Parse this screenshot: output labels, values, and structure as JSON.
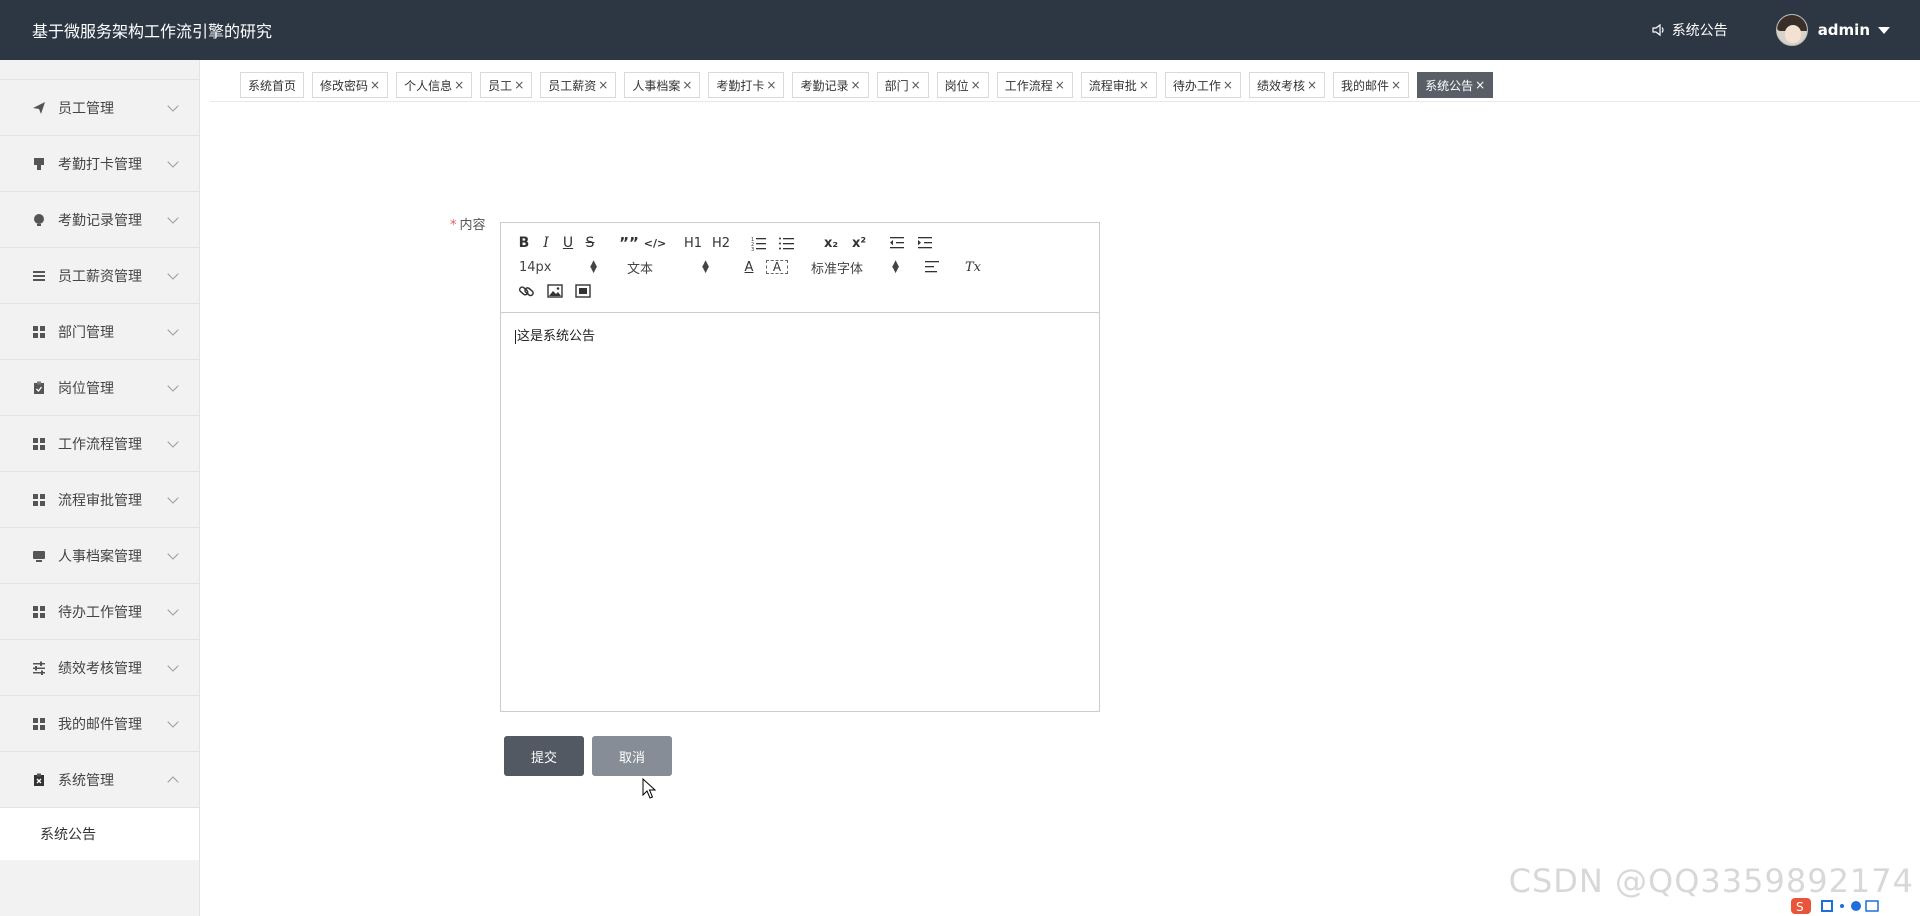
{
  "header": {
    "app_title": "基于微服务架构工作流引擎的研究",
    "notice_label": "系统公告",
    "username": "admin"
  },
  "sidebar": {
    "items": [
      {
        "label": "员工管理",
        "icon": "send-icon"
      },
      {
        "label": "考勤打卡管理",
        "icon": "stamp-icon"
      },
      {
        "label": "考勤记录管理",
        "icon": "bulb-icon"
      },
      {
        "label": "员工薪资管理",
        "icon": "list-icon"
      },
      {
        "label": "部门管理",
        "icon": "grid-icon"
      },
      {
        "label": "岗位管理",
        "icon": "clipboard-icon"
      },
      {
        "label": "工作流程管理",
        "icon": "grid-icon"
      },
      {
        "label": "流程审批管理",
        "icon": "grid-icon"
      },
      {
        "label": "人事档案管理",
        "icon": "monitor-icon"
      },
      {
        "label": "待办工作管理",
        "icon": "grid-icon"
      },
      {
        "label": "绩效考核管理",
        "icon": "sliders-icon"
      },
      {
        "label": "我的邮件管理",
        "icon": "grid-icon"
      },
      {
        "label": "系统管理",
        "icon": "clipboard-x-icon"
      }
    ],
    "sub_item": "系统公告"
  },
  "tabs": [
    {
      "label": "系统首页",
      "closable": false
    },
    {
      "label": "修改密码",
      "closable": true
    },
    {
      "label": "个人信息",
      "closable": true
    },
    {
      "label": "员工",
      "closable": true
    },
    {
      "label": "员工薪资",
      "closable": true
    },
    {
      "label": "人事档案",
      "closable": true
    },
    {
      "label": "考勤打卡",
      "closable": true
    },
    {
      "label": "考勤记录",
      "closable": true
    },
    {
      "label": "部门",
      "closable": true
    },
    {
      "label": "岗位",
      "closable": true
    },
    {
      "label": "工作流程",
      "closable": true
    },
    {
      "label": "流程审批",
      "closable": true
    },
    {
      "label": "待办工作",
      "closable": true
    },
    {
      "label": "绩效考核",
      "closable": true
    },
    {
      "label": "我的邮件",
      "closable": true
    },
    {
      "label": "系统公告",
      "closable": true,
      "active": true
    }
  ],
  "tab_close_glyph": "×",
  "form": {
    "required_mark": "*",
    "content_label": "内容",
    "editor_text": "这是系统公告",
    "font_size": "14px",
    "header_select": "文本",
    "font_family": "标准字体",
    "submit_label": "提交",
    "cancel_label": "取消"
  },
  "toolbar_glyphs": {
    "bold": "B",
    "italic": "I",
    "underline": "U",
    "strike": "S",
    "quote": "””",
    "code": "</>",
    "h1": "H1",
    "h2": "H2",
    "subscript": "x₂",
    "superscript": "x²",
    "color": "A",
    "background": "A",
    "clean": "Tx"
  },
  "watermark": "CSDN @QQ3359892174",
  "colors": {
    "header_bg": "#2d3643",
    "submit_bg": "#525963",
    "cancel_bg": "#878d96",
    "active_tab_bg": "#5a5f67"
  }
}
